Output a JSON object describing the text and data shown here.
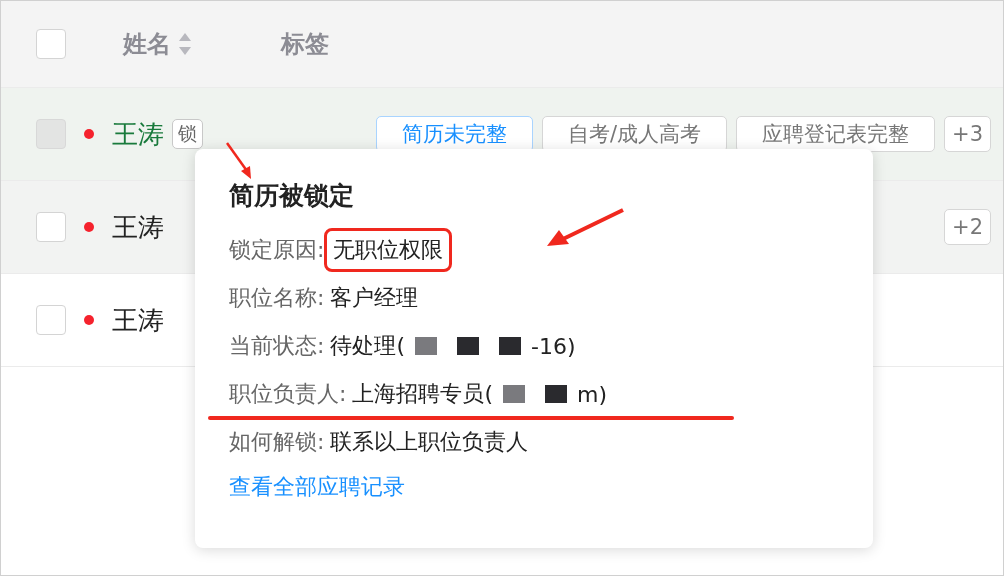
{
  "table": {
    "header_checkbox": {
      "checked": false
    },
    "columns": [
      {
        "label": "姓名",
        "sortable": true
      },
      {
        "label": "标签",
        "sortable": false
      }
    ],
    "rows": [
      {
        "checkbox": {
          "checked": false,
          "disabled": true
        },
        "status_dot": {
          "color": "#f5222d"
        },
        "name": "王涛",
        "selected": true,
        "lock_badge": "锁",
        "tags": [
          {
            "label": "简历未完整",
            "kind": "primary"
          },
          {
            "label": "自考/成人高考",
            "kind": "default"
          },
          {
            "label": "应聘登记表完整",
            "kind": "default"
          }
        ],
        "more": "+3"
      },
      {
        "checkbox": {
          "checked": false,
          "disabled": false
        },
        "status_dot": {
          "color": "#f5222d"
        },
        "name": "王涛",
        "selected": false,
        "shaded": true,
        "tags": [],
        "more": "+2"
      },
      {
        "checkbox": {
          "checked": false,
          "disabled": false
        },
        "status_dot": {
          "color": "#f5222d"
        },
        "name": "王涛",
        "selected": false,
        "shaded": false,
        "tags": []
      }
    ]
  },
  "popover": {
    "title": "简历被锁定",
    "fields": [
      {
        "label": "锁定原因:",
        "boxed": true,
        "underlined": false,
        "value": [
          {
            "kind": "text",
            "text": "无职位权限"
          }
        ]
      },
      {
        "label": "职位名称:",
        "boxed": false,
        "underlined": false,
        "value": [
          {
            "kind": "text",
            "text": "客户经理"
          }
        ]
      },
      {
        "label": "当前状态:",
        "boxed": false,
        "underlined": false,
        "value": [
          {
            "kind": "text",
            "text": "待处理("
          },
          {
            "kind": "redaction",
            "color": "#7a7a7e"
          },
          {
            "kind": "redaction",
            "color": "#2a2a2e"
          },
          {
            "kind": "redaction",
            "color": "#2a2a2e"
          },
          {
            "kind": "text",
            "text": "-16)"
          }
        ]
      },
      {
        "label": "职位负责人:",
        "boxed": false,
        "underlined": true,
        "value": [
          {
            "kind": "text",
            "text": "上海招聘专员("
          },
          {
            "kind": "redaction",
            "color": "#7a7a7e"
          },
          {
            "kind": "redaction",
            "color": "#2a2a2e"
          },
          {
            "kind": "text",
            "text": "m)"
          }
        ]
      },
      {
        "label": "如何解锁:",
        "boxed": false,
        "underlined": false,
        "value": [
          {
            "kind": "text",
            "text": "联系以上职位负责人"
          }
        ]
      }
    ],
    "link": "查看全部应聘记录"
  }
}
